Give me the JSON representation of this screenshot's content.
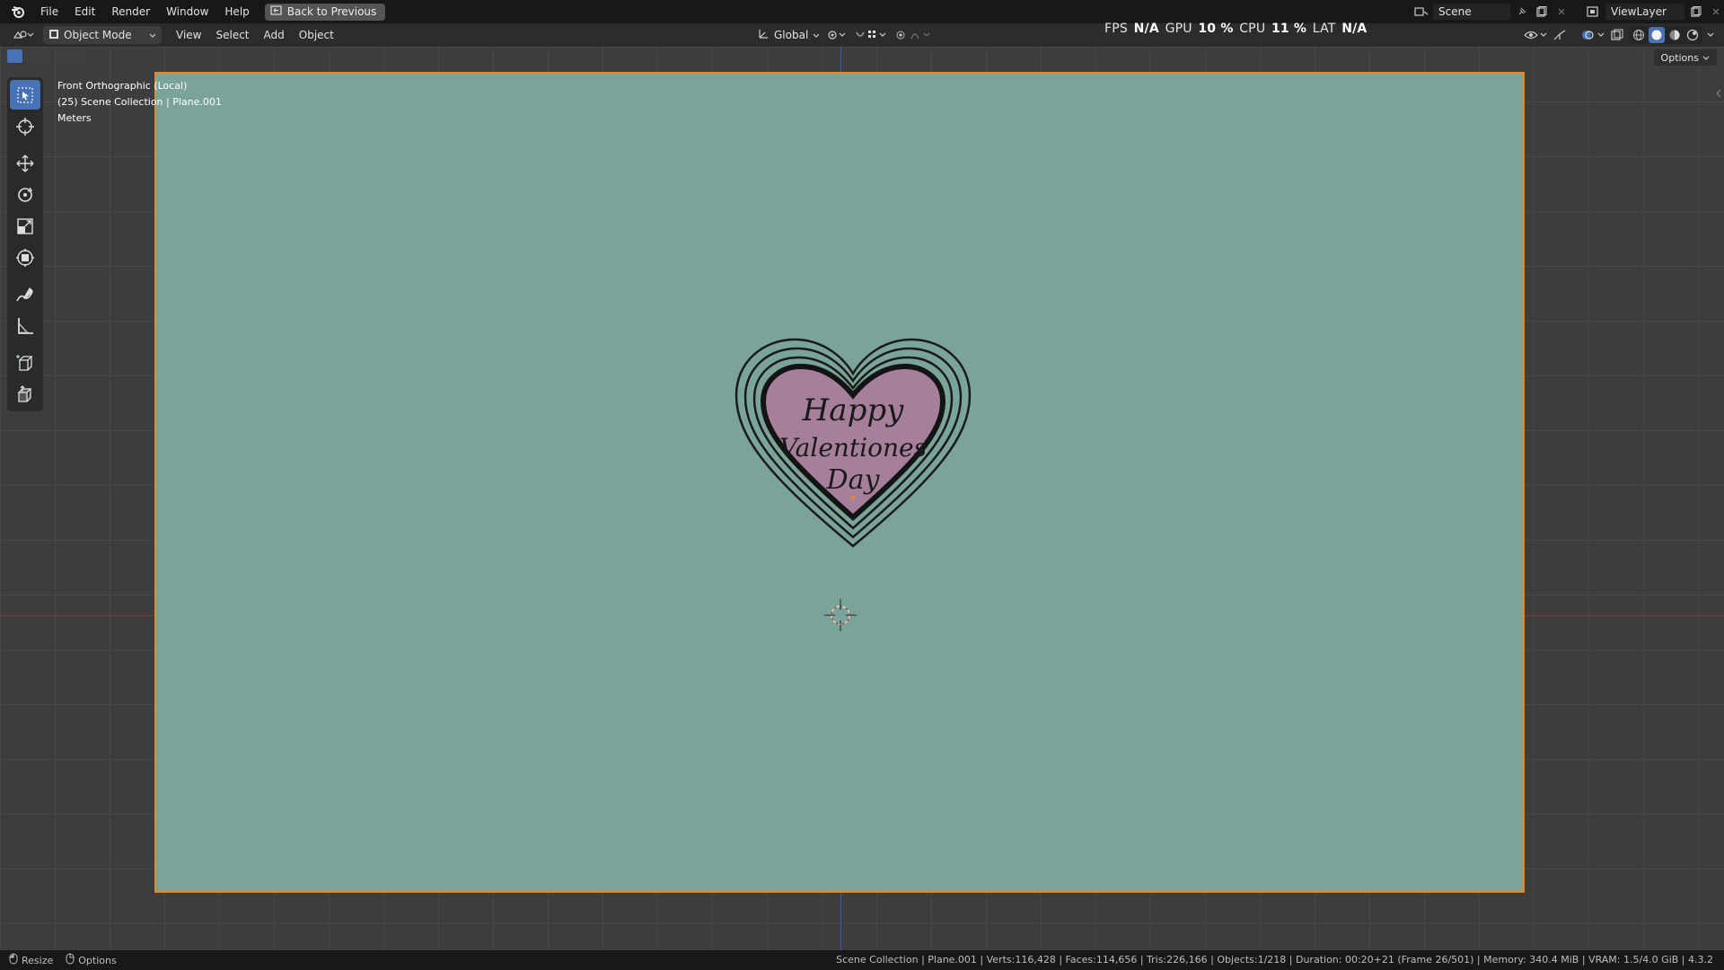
{
  "topbar": {
    "menus": [
      "File",
      "Edit",
      "Render",
      "Window",
      "Help"
    ],
    "back_label": "Back to Previous",
    "scene_label": "Scene",
    "viewlayer_label": "ViewLayer"
  },
  "header": {
    "mode_label": "Object Mode",
    "menus": [
      "View",
      "Select",
      "Add",
      "Object"
    ],
    "transform_orientation": "Global"
  },
  "stats": {
    "fps_label": "FPS",
    "fps_value": "N/A",
    "gpu_label": "GPU",
    "gpu_value": "10 %",
    "cpu_label": "CPU",
    "cpu_value": "11 %",
    "lat_label": "LAT",
    "lat_value": "N/A"
  },
  "viewport": {
    "view_name": "Front Orthographic (Local)",
    "collection_info": "(25) Scene Collection | Plane.001",
    "units": "Meters",
    "options_label": "Options",
    "frame_color": "#e08a2c",
    "background_color": "#7aa49a"
  },
  "heart": {
    "line1": "Happy",
    "line2": "Valentiones",
    "line3": "Day",
    "fill_color": "#a6809b"
  },
  "tools": [
    "select-box-icon",
    "cursor-icon",
    "move-icon",
    "rotate-icon",
    "scale-icon",
    "transform-icon",
    "annotate-icon",
    "measure-icon",
    "add-cube-icon",
    "extrude-icon"
  ],
  "statusbar": {
    "resize_label": "Resize",
    "options_label": "Options",
    "info": "Scene Collection | Plane.001 | Verts:116,428 | Faces:114,656 | Tris:226,166 | Objects:1/218 | Duration: 00:20+21 (Frame 26/501) | Memory: 340.4 MiB | VRAM: 1.5/4.0 GiB | 4.3.2"
  }
}
